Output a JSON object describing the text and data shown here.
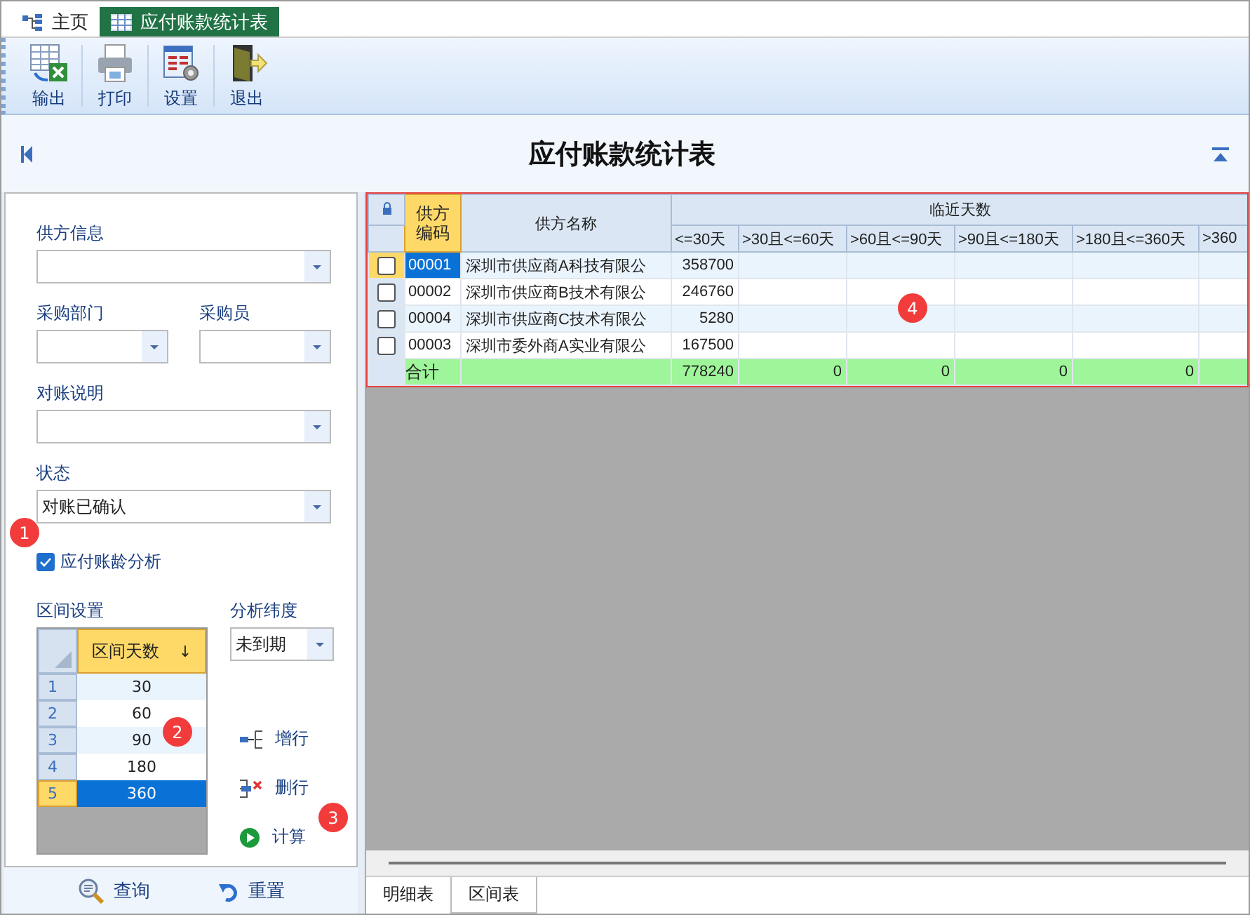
{
  "tabs": [
    {
      "label": "主页",
      "selected": false
    },
    {
      "label": "应付账款统计表",
      "selected": true
    }
  ],
  "toolbar": [
    {
      "label": "输出"
    },
    {
      "label": "打印"
    },
    {
      "label": "设置"
    },
    {
      "label": "退出"
    }
  ],
  "title": "应付账款统计表",
  "form": {
    "supplier": {
      "label": "供方信息"
    },
    "department": {
      "label": "采购部门"
    },
    "buyer": {
      "label": "采购员"
    },
    "note": {
      "label": "对账说明"
    },
    "status": {
      "label": "状态",
      "value": "对账已确认"
    },
    "aging_analysis": {
      "label": "应付账龄分析",
      "checked": true
    },
    "interval": {
      "label": "区间设置",
      "column": "区间天数",
      "sort_mark": "↓",
      "rows": [
        {
          "index": "1",
          "days": "30",
          "selected": false
        },
        {
          "index": "2",
          "days": "60",
          "selected": false
        },
        {
          "index": "3",
          "days": "90",
          "selected": false
        },
        {
          "index": "4",
          "days": "180",
          "selected": false
        },
        {
          "index": "5",
          "days": "360",
          "selected": true
        }
      ]
    },
    "dimension": {
      "label": "分析纬度",
      "value": "未到期"
    },
    "actions": [
      {
        "label": "增行"
      },
      {
        "label": "删行"
      },
      {
        "label": "计算"
      }
    ]
  },
  "bottom_buttons": [
    {
      "label": "查询"
    },
    {
      "label": "重置"
    }
  ],
  "grid": {
    "code_header": "供方编码",
    "name_header": "供方名称",
    "group_header": "临近天数",
    "day_columns": [
      "<=30天",
      ">30且<=60天",
      ">60且<=90天",
      ">90且<=180天",
      ">180且<=360天",
      ">360"
    ],
    "rows": [
      {
        "checked": false,
        "selected": true,
        "code": "00001",
        "name": "深圳市供应商A科技有限公",
        "values": [
          "358700"
        ]
      },
      {
        "checked": false,
        "selected": false,
        "code": "00002",
        "name": "深圳市供应商B技术有限公",
        "values": [
          "246760"
        ]
      },
      {
        "checked": false,
        "selected": false,
        "code": "00004",
        "name": "深圳市供应商C技术有限公",
        "values": [
          "5280"
        ]
      },
      {
        "checked": false,
        "selected": false,
        "code": "00003",
        "name": "深圳市委外商A实业有限公",
        "values": [
          "167500"
        ]
      }
    ],
    "total": {
      "label": "合计",
      "values": [
        "778240",
        "0",
        "0",
        "0",
        "0"
      ]
    }
  },
  "sheet_tabs": [
    {
      "label": "明细表",
      "selected": true
    },
    {
      "label": "区间表",
      "selected": false
    }
  ],
  "markers": [
    {
      "label": "1"
    },
    {
      "label": "2"
    },
    {
      "label": "3"
    },
    {
      "label": "4"
    }
  ]
}
